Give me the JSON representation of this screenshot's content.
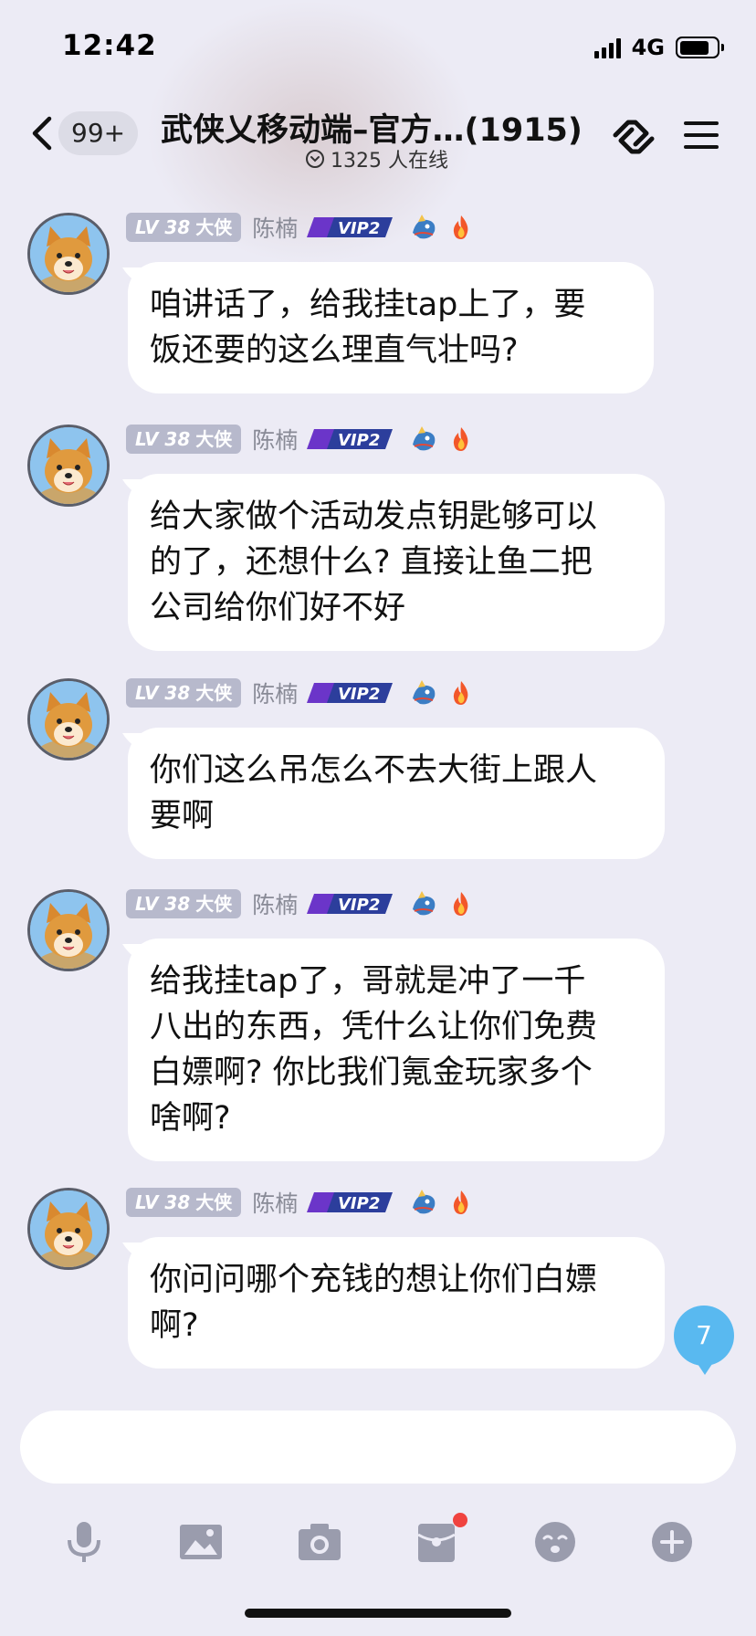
{
  "status_bar": {
    "time": "12:42",
    "network": "4G"
  },
  "header": {
    "unread_count": "99+",
    "title": "武侠乂移动端–官方…(1915)",
    "online_text": "1325 人在线"
  },
  "messages": [
    {
      "level": "LV 38",
      "rank": "大侠",
      "nickname": "陈楠",
      "vip": "VIP2",
      "lines": [
        "咱讲话了，给我挂tap上了，要",
        "饭还要的这么理直气壮吗?"
      ]
    },
    {
      "level": "LV 38",
      "rank": "大侠",
      "nickname": "陈楠",
      "vip": "VIP2",
      "lines": [
        "给大家做个活动发点钥匙够可以",
        "的了，还想什么? 直接让鱼二把",
        "公司给你们好不好"
      ]
    },
    {
      "level": "LV 38",
      "rank": "大侠",
      "nickname": "陈楠",
      "vip": "VIP2",
      "lines": [
        "你们这么吊怎么不去大街上跟人",
        "要啊"
      ]
    },
    {
      "level": "LV 38",
      "rank": "大侠",
      "nickname": "陈楠",
      "vip": "VIP2",
      "lines": [
        "给我挂tap了，哥就是冲了一千",
        "八出的东西，凭什么让你们免费",
        "白嫖啊? 你比我们氪金玩家多个",
        "啥啊?"
      ]
    },
    {
      "level": "LV 38",
      "rank": "大侠",
      "nickname": "陈楠",
      "vip": "VIP2",
      "lines": [
        "你问问哪个充钱的想让你们白嫖",
        "啊?"
      ]
    }
  ],
  "unread_new": "7",
  "input": {
    "value": "",
    "placeholder": ""
  },
  "toolbar": {
    "icons": [
      "microphone-icon",
      "image-icon",
      "camera-icon",
      "red-packet-icon",
      "emoji-icon",
      "plus-icon"
    ],
    "has_notification_on": "red-packet-icon"
  },
  "colors": {
    "background": "#ecebf5",
    "bubble": "#ffffff",
    "level_badge": "#b7b9cc",
    "unread_badge": "#59b9f0",
    "notification_dot": "#f0433f",
    "toolbar_icons": "#9a9cad"
  }
}
